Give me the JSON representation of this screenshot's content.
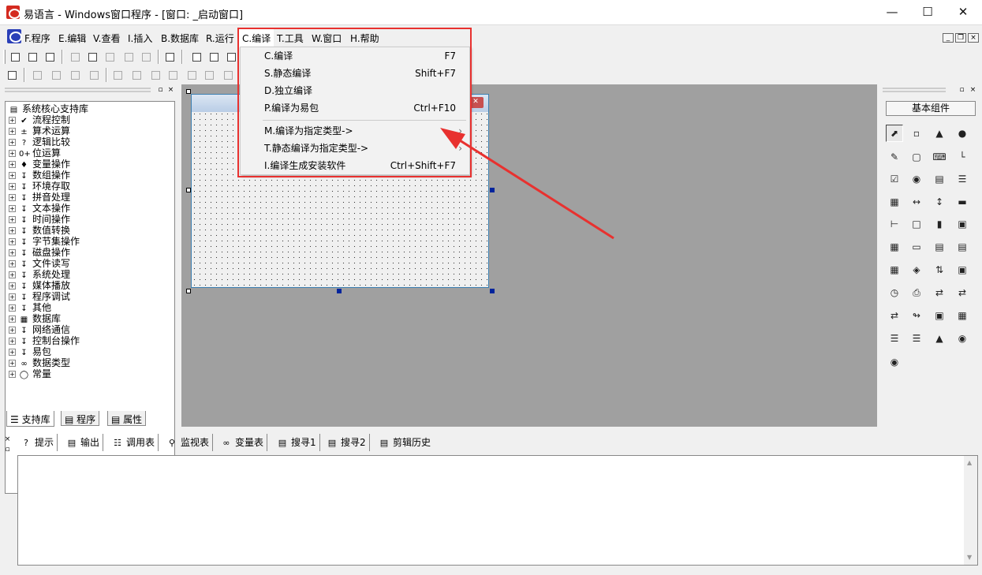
{
  "window": {
    "title": "易语言 - Windows窗口程序 - [窗口: _启动窗口]"
  },
  "menubar": {
    "items": [
      "F.程序",
      "E.编辑",
      "V.查看",
      "I.插入",
      "B.数据库",
      "R.运行",
      "C.编译",
      "T.工具",
      "W.窗口",
      "H.帮助"
    ],
    "active": "C.编译"
  },
  "compile_menu": {
    "items": [
      {
        "label": "C.编译",
        "shortcut": "F7"
      },
      {
        "label": "S.静态编译",
        "shortcut": "Shift+F7"
      },
      {
        "label": "D.独立编译",
        "shortcut": ""
      },
      {
        "label": "P.编译为易包",
        "shortcut": "Ctrl+F10"
      },
      {
        "label": "M.编译为指定类型->",
        "shortcut": "",
        "submenu": true
      },
      {
        "label": "T.静态编译为指定类型->",
        "shortcut": "",
        "submenu": true
      },
      {
        "label": "I.编译生成安装软件",
        "shortcut": "Ctrl+Shift+F7"
      }
    ]
  },
  "support_tree": {
    "root": "系统核心支持库",
    "items": [
      "流程控制",
      "算术运算",
      "逻辑比较",
      "位运算",
      "变量操作",
      "数组操作",
      "环境存取",
      "拼音处理",
      "文本操作",
      "时间操作",
      "数值转换",
      "字节集操作",
      "磁盘操作",
      "文件读写",
      "系统处理",
      "媒体播放",
      "程序调试",
      "其他",
      "数据库",
      "网络通信",
      "控制台操作",
      "易包",
      "数据类型",
      "常量"
    ]
  },
  "left_tabs": [
    "支持库",
    "程序",
    "属性"
  ],
  "component_panel": {
    "title": "基本组件"
  },
  "bottom_tabs": [
    "提示",
    "输出",
    "调用表",
    "监视表",
    "变量表",
    "搜寻1",
    "搜寻2",
    "剪辑历史"
  ],
  "colors": {
    "highlight": "#e8312f",
    "designer_bg": "#a0a0a0"
  }
}
